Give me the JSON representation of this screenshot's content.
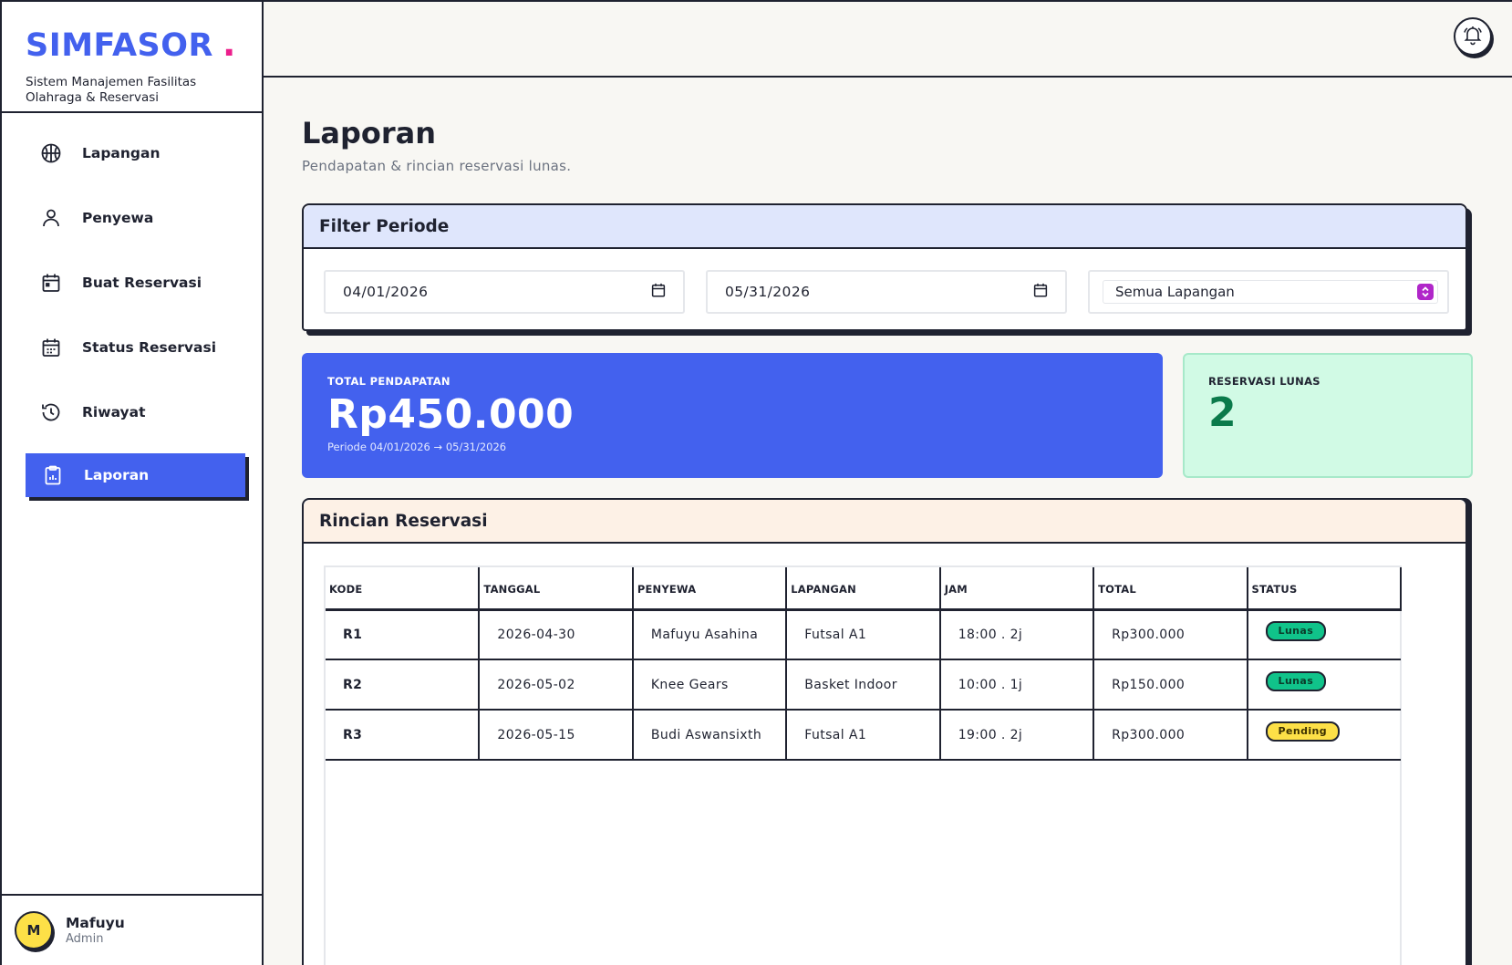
{
  "brand": {
    "name": "SIMFASOR",
    "dot": ".",
    "subtitle": "Sistem Manajemen Fasilitas Olahraga & Reservasi"
  },
  "nav": [
    {
      "label": "Lapangan",
      "icon": "basketball-icon"
    },
    {
      "label": "Penyewa",
      "icon": "user-icon"
    },
    {
      "label": "Buat Reservasi",
      "icon": "calendar-icon"
    },
    {
      "label": "Status Reservasi",
      "icon": "calendar-check-icon"
    },
    {
      "label": "Riwayat",
      "icon": "history-icon"
    },
    {
      "label": "Laporan",
      "icon": "report-icon",
      "active": true
    }
  ],
  "user": {
    "initial": "M",
    "name": "Mafuyu",
    "role": "Admin"
  },
  "page": {
    "title": "Laporan",
    "subtitle": "Pendapatan & rincian reservasi lunas."
  },
  "filter": {
    "title": "Filter Periode",
    "start_date": "04/01/2026",
    "end_date": "05/31/2026",
    "court_select": "Semua Lapangan"
  },
  "stats": {
    "revenue_label": "TOTAL PENDAPATAN",
    "revenue_value": "Rp450.000",
    "revenue_period": "Periode 04/01/2026 → 05/31/2026",
    "paid_label": "RESERVASI LUNAS",
    "paid_value": "2"
  },
  "detail": {
    "title": "Rincian Reservasi",
    "columns": [
      "KODE",
      "TANGGAL",
      "PENYEWA",
      "LAPANGAN",
      "JAM",
      "TOTAL",
      "STATUS"
    ],
    "rows": [
      {
        "kode": "R1",
        "tanggal": "2026-04-30",
        "penyewa": "Mafuyu Asahina",
        "lapangan": "Futsal A1",
        "jam": "18:00 . 2j",
        "total": "Rp300.000",
        "status": "Lunas"
      },
      {
        "kode": "R2",
        "tanggal": "2026-05-02",
        "penyewa": "Knee Gears",
        "lapangan": "Basket Indoor",
        "jam": "10:00 . 1j",
        "total": "Rp150.000",
        "status": "Lunas"
      },
      {
        "kode": "R3",
        "tanggal": "2026-05-15",
        "penyewa": "Budi Aswansixth",
        "lapangan": "Futsal A1",
        "jam": "19:00 . 2j",
        "total": "Rp300.000",
        "status": "Pending"
      }
    ]
  },
  "colors": {
    "accent": "#4361ee",
    "brand_dot": "#ec1f8c",
    "paid_bg": "#d1fae5",
    "lunas": "#10c38a",
    "pending": "#fde047"
  }
}
